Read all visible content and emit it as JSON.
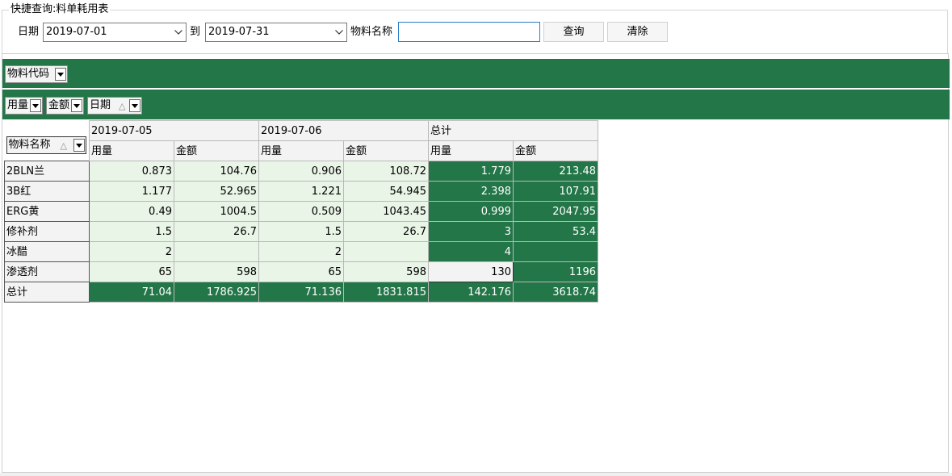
{
  "query": {
    "group_title": "快捷查询:料单耗用表",
    "date_label": "日期",
    "date_from": "2019-07-01",
    "to_label": "到",
    "date_to": "2019-07-31",
    "material_label": "物料名称",
    "material_value": "",
    "search_button": "查询",
    "clear_button": "清除"
  },
  "pivot": {
    "filter_field": "物料代码",
    "column_fields": [
      "用量",
      "金额",
      "日期"
    ],
    "row_field": "物料名称",
    "sort_symbol": "△",
    "column_groups": [
      "2019-07-05",
      "2019-07-06",
      "总计"
    ],
    "measures": [
      "用量",
      "金额"
    ],
    "rows": [
      {
        "name": "2BLN兰",
        "d1_qty": "0.873",
        "d1_amt": "104.76",
        "d2_qty": "0.906",
        "d2_amt": "108.72",
        "t_qty": "1.779",
        "t_amt": "213.48"
      },
      {
        "name": "3B红",
        "d1_qty": "1.177",
        "d1_amt": "52.965",
        "d2_qty": "1.221",
        "d2_amt": "54.945",
        "t_qty": "2.398",
        "t_amt": "107.91"
      },
      {
        "name": "ERG黄",
        "d1_qty": "0.49",
        "d1_amt": "1004.5",
        "d2_qty": "0.509",
        "d2_amt": "1043.45",
        "t_qty": "0.999",
        "t_amt": "2047.95"
      },
      {
        "name": "修补剂",
        "d1_qty": "1.5",
        "d1_amt": "26.7",
        "d2_qty": "1.5",
        "d2_amt": "26.7",
        "t_qty": "3",
        "t_amt": "53.4"
      },
      {
        "name": "冰醋",
        "d1_qty": "2",
        "d1_amt": "",
        "d2_qty": "2",
        "d2_amt": "",
        "t_qty": "4",
        "t_amt": ""
      },
      {
        "name": "渗透剂",
        "d1_qty": "65",
        "d1_amt": "598",
        "d2_qty": "65",
        "d2_amt": "598",
        "t_qty": "130",
        "t_amt": "1196"
      }
    ],
    "total_row": {
      "name": "总计",
      "d1_qty": "71.04",
      "d1_amt": "1786.925",
      "d2_qty": "71.136",
      "d2_amt": "1831.815",
      "t_qty": "142.176",
      "t_amt": "3618.74"
    }
  },
  "colors": {
    "accent_green": "#237648",
    "cell_light_green": "#e9f5e7",
    "input_focus_blue": "#2a7fc4"
  }
}
